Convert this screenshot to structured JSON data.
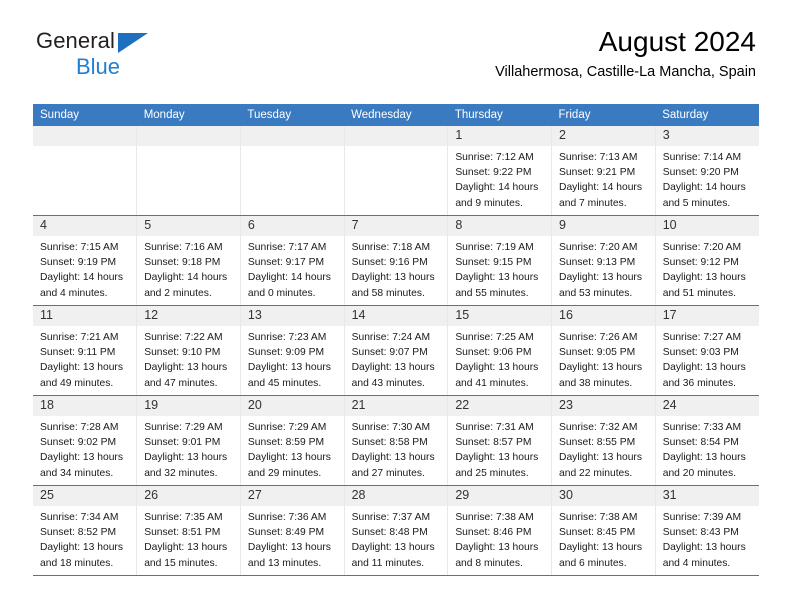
{
  "brand": {
    "line1": "General",
    "line2": "Blue",
    "icon": "triangle-logo"
  },
  "header": {
    "title": "August 2024",
    "subtitle": "Villahermosa, Castille-La Mancha, Spain"
  },
  "colors": {
    "header_blue": "#3a7ac0",
    "brand_blue": "#1f7fd4",
    "daynum_band": "#f0f0f0",
    "text": "#000000"
  },
  "weekdays": [
    "Sunday",
    "Monday",
    "Tuesday",
    "Wednesday",
    "Thursday",
    "Friday",
    "Saturday"
  ],
  "weeks": [
    [
      {
        "day": "",
        "lines": []
      },
      {
        "day": "",
        "lines": []
      },
      {
        "day": "",
        "lines": []
      },
      {
        "day": "",
        "lines": []
      },
      {
        "day": "1",
        "lines": [
          "Sunrise: 7:12 AM",
          "Sunset: 9:22 PM",
          "Daylight: 14 hours",
          "and 9 minutes."
        ]
      },
      {
        "day": "2",
        "lines": [
          "Sunrise: 7:13 AM",
          "Sunset: 9:21 PM",
          "Daylight: 14 hours",
          "and 7 minutes."
        ]
      },
      {
        "day": "3",
        "lines": [
          "Sunrise: 7:14 AM",
          "Sunset: 9:20 PM",
          "Daylight: 14 hours",
          "and 5 minutes."
        ]
      }
    ],
    [
      {
        "day": "4",
        "lines": [
          "Sunrise: 7:15 AM",
          "Sunset: 9:19 PM",
          "Daylight: 14 hours",
          "and 4 minutes."
        ]
      },
      {
        "day": "5",
        "lines": [
          "Sunrise: 7:16 AM",
          "Sunset: 9:18 PM",
          "Daylight: 14 hours",
          "and 2 minutes."
        ]
      },
      {
        "day": "6",
        "lines": [
          "Sunrise: 7:17 AM",
          "Sunset: 9:17 PM",
          "Daylight: 14 hours",
          "and 0 minutes."
        ]
      },
      {
        "day": "7",
        "lines": [
          "Sunrise: 7:18 AM",
          "Sunset: 9:16 PM",
          "Daylight: 13 hours",
          "and 58 minutes."
        ]
      },
      {
        "day": "8",
        "lines": [
          "Sunrise: 7:19 AM",
          "Sunset: 9:15 PM",
          "Daylight: 13 hours",
          "and 55 minutes."
        ]
      },
      {
        "day": "9",
        "lines": [
          "Sunrise: 7:20 AM",
          "Sunset: 9:13 PM",
          "Daylight: 13 hours",
          "and 53 minutes."
        ]
      },
      {
        "day": "10",
        "lines": [
          "Sunrise: 7:20 AM",
          "Sunset: 9:12 PM",
          "Daylight: 13 hours",
          "and 51 minutes."
        ]
      }
    ],
    [
      {
        "day": "11",
        "lines": [
          "Sunrise: 7:21 AM",
          "Sunset: 9:11 PM",
          "Daylight: 13 hours",
          "and 49 minutes."
        ]
      },
      {
        "day": "12",
        "lines": [
          "Sunrise: 7:22 AM",
          "Sunset: 9:10 PM",
          "Daylight: 13 hours",
          "and 47 minutes."
        ]
      },
      {
        "day": "13",
        "lines": [
          "Sunrise: 7:23 AM",
          "Sunset: 9:09 PM",
          "Daylight: 13 hours",
          "and 45 minutes."
        ]
      },
      {
        "day": "14",
        "lines": [
          "Sunrise: 7:24 AM",
          "Sunset: 9:07 PM",
          "Daylight: 13 hours",
          "and 43 minutes."
        ]
      },
      {
        "day": "15",
        "lines": [
          "Sunrise: 7:25 AM",
          "Sunset: 9:06 PM",
          "Daylight: 13 hours",
          "and 41 minutes."
        ]
      },
      {
        "day": "16",
        "lines": [
          "Sunrise: 7:26 AM",
          "Sunset: 9:05 PM",
          "Daylight: 13 hours",
          "and 38 minutes."
        ]
      },
      {
        "day": "17",
        "lines": [
          "Sunrise: 7:27 AM",
          "Sunset: 9:03 PM",
          "Daylight: 13 hours",
          "and 36 minutes."
        ]
      }
    ],
    [
      {
        "day": "18",
        "lines": [
          "Sunrise: 7:28 AM",
          "Sunset: 9:02 PM",
          "Daylight: 13 hours",
          "and 34 minutes."
        ]
      },
      {
        "day": "19",
        "lines": [
          "Sunrise: 7:29 AM",
          "Sunset: 9:01 PM",
          "Daylight: 13 hours",
          "and 32 minutes."
        ]
      },
      {
        "day": "20",
        "lines": [
          "Sunrise: 7:29 AM",
          "Sunset: 8:59 PM",
          "Daylight: 13 hours",
          "and 29 minutes."
        ]
      },
      {
        "day": "21",
        "lines": [
          "Sunrise: 7:30 AM",
          "Sunset: 8:58 PM",
          "Daylight: 13 hours",
          "and 27 minutes."
        ]
      },
      {
        "day": "22",
        "lines": [
          "Sunrise: 7:31 AM",
          "Sunset: 8:57 PM",
          "Daylight: 13 hours",
          "and 25 minutes."
        ]
      },
      {
        "day": "23",
        "lines": [
          "Sunrise: 7:32 AM",
          "Sunset: 8:55 PM",
          "Daylight: 13 hours",
          "and 22 minutes."
        ]
      },
      {
        "day": "24",
        "lines": [
          "Sunrise: 7:33 AM",
          "Sunset: 8:54 PM",
          "Daylight: 13 hours",
          "and 20 minutes."
        ]
      }
    ],
    [
      {
        "day": "25",
        "lines": [
          "Sunrise: 7:34 AM",
          "Sunset: 8:52 PM",
          "Daylight: 13 hours",
          "and 18 minutes."
        ]
      },
      {
        "day": "26",
        "lines": [
          "Sunrise: 7:35 AM",
          "Sunset: 8:51 PM",
          "Daylight: 13 hours",
          "and 15 minutes."
        ]
      },
      {
        "day": "27",
        "lines": [
          "Sunrise: 7:36 AM",
          "Sunset: 8:49 PM",
          "Daylight: 13 hours",
          "and 13 minutes."
        ]
      },
      {
        "day": "28",
        "lines": [
          "Sunrise: 7:37 AM",
          "Sunset: 8:48 PM",
          "Daylight: 13 hours",
          "and 11 minutes."
        ]
      },
      {
        "day": "29",
        "lines": [
          "Sunrise: 7:38 AM",
          "Sunset: 8:46 PM",
          "Daylight: 13 hours",
          "and 8 minutes."
        ]
      },
      {
        "day": "30",
        "lines": [
          "Sunrise: 7:38 AM",
          "Sunset: 8:45 PM",
          "Daylight: 13 hours",
          "and 6 minutes."
        ]
      },
      {
        "day": "31",
        "lines": [
          "Sunrise: 7:39 AM",
          "Sunset: 8:43 PM",
          "Daylight: 13 hours",
          "and 4 minutes."
        ]
      }
    ]
  ]
}
